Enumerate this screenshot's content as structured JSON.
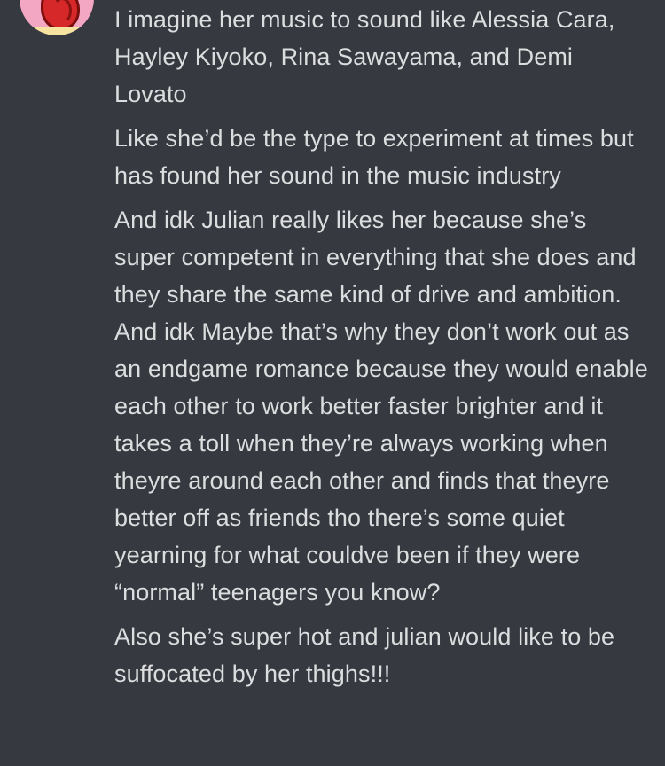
{
  "messages": [
    "I imagine her music to sound like Alessia Cara, Hayley Kiyoko, Rina Sawayama, and Demi Lovato",
    "Like she’d be the type to experiment at times but has found her sound in the music industry",
    "And idk Julian really likes her because she’s super competent in everything that she does and they share the same kind of drive and ambition. And idk Maybe that’s why they don’t work out as an endgame romance because they would enable each other to work better faster brighter and it takes a toll when they’re always working when theyre around each other and finds that theyre better off as friends tho there’s some quiet yearning for what couldve been if they were “normal” teenagers you know?",
    "Also she’s super hot and julian would like to be suffocated by her thighs!!!"
  ],
  "colors": {
    "background": "#36393f",
    "text": "#dcddde",
    "avatar_bg": "#f4a7c3"
  }
}
